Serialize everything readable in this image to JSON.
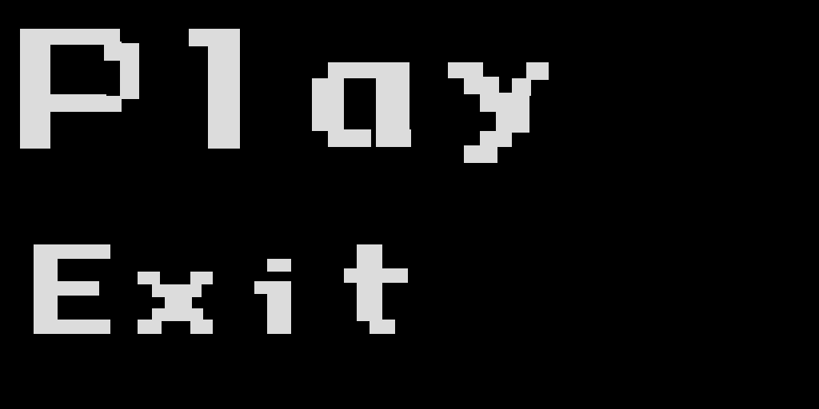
{
  "screen": {
    "background_color": "#000000",
    "text_color": "#dcdcdc"
  },
  "menu": {
    "items": [
      {
        "id": "play",
        "label": "Play"
      },
      {
        "id": "exit",
        "label": "Exit"
      }
    ]
  }
}
